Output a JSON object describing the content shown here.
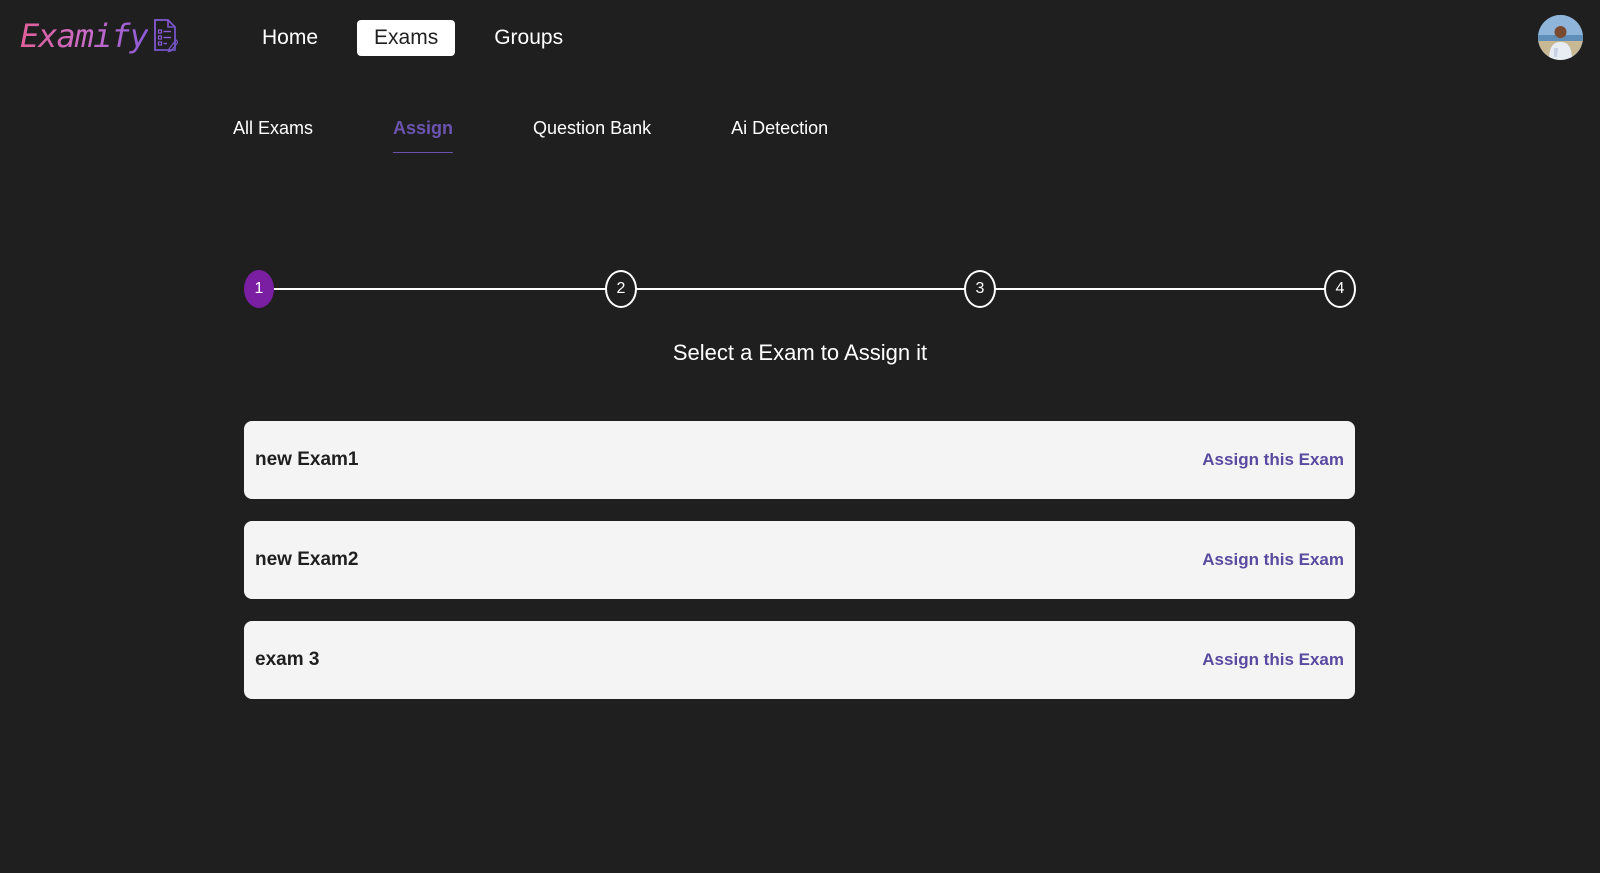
{
  "brand": {
    "name": "Examify",
    "icon": "exam-document-icon"
  },
  "nav": {
    "items": [
      {
        "label": "Home",
        "active": false
      },
      {
        "label": "Exams",
        "active": true
      },
      {
        "label": "Groups",
        "active": false
      }
    ]
  },
  "user": {
    "avatar": "user-avatar"
  },
  "subtabs": {
    "items": [
      {
        "label": "All Exams",
        "active": false
      },
      {
        "label": "Assign",
        "active": true
      },
      {
        "label": "Question Bank",
        "active": false
      },
      {
        "label": "Ai Detection",
        "active": false
      }
    ]
  },
  "stepper": {
    "steps": [
      "1",
      "2",
      "3",
      "4"
    ],
    "current_step": 1,
    "caption": "Select a Exam to Assign it"
  },
  "exams": [
    {
      "name": "new Exam1",
      "action": "Assign this Exam"
    },
    {
      "name": "new Exam2",
      "action": "Assign this Exam"
    },
    {
      "name": "exam 3",
      "action": "Assign this Exam"
    }
  ],
  "colors": {
    "background": "#1f1f1f",
    "accent": "#6b54b0",
    "step_active": "#7b1fa2",
    "card": "#f4f4f4",
    "brand_gradient_start": "#e0609a",
    "brand_gradient_end": "#8a5ad8"
  }
}
